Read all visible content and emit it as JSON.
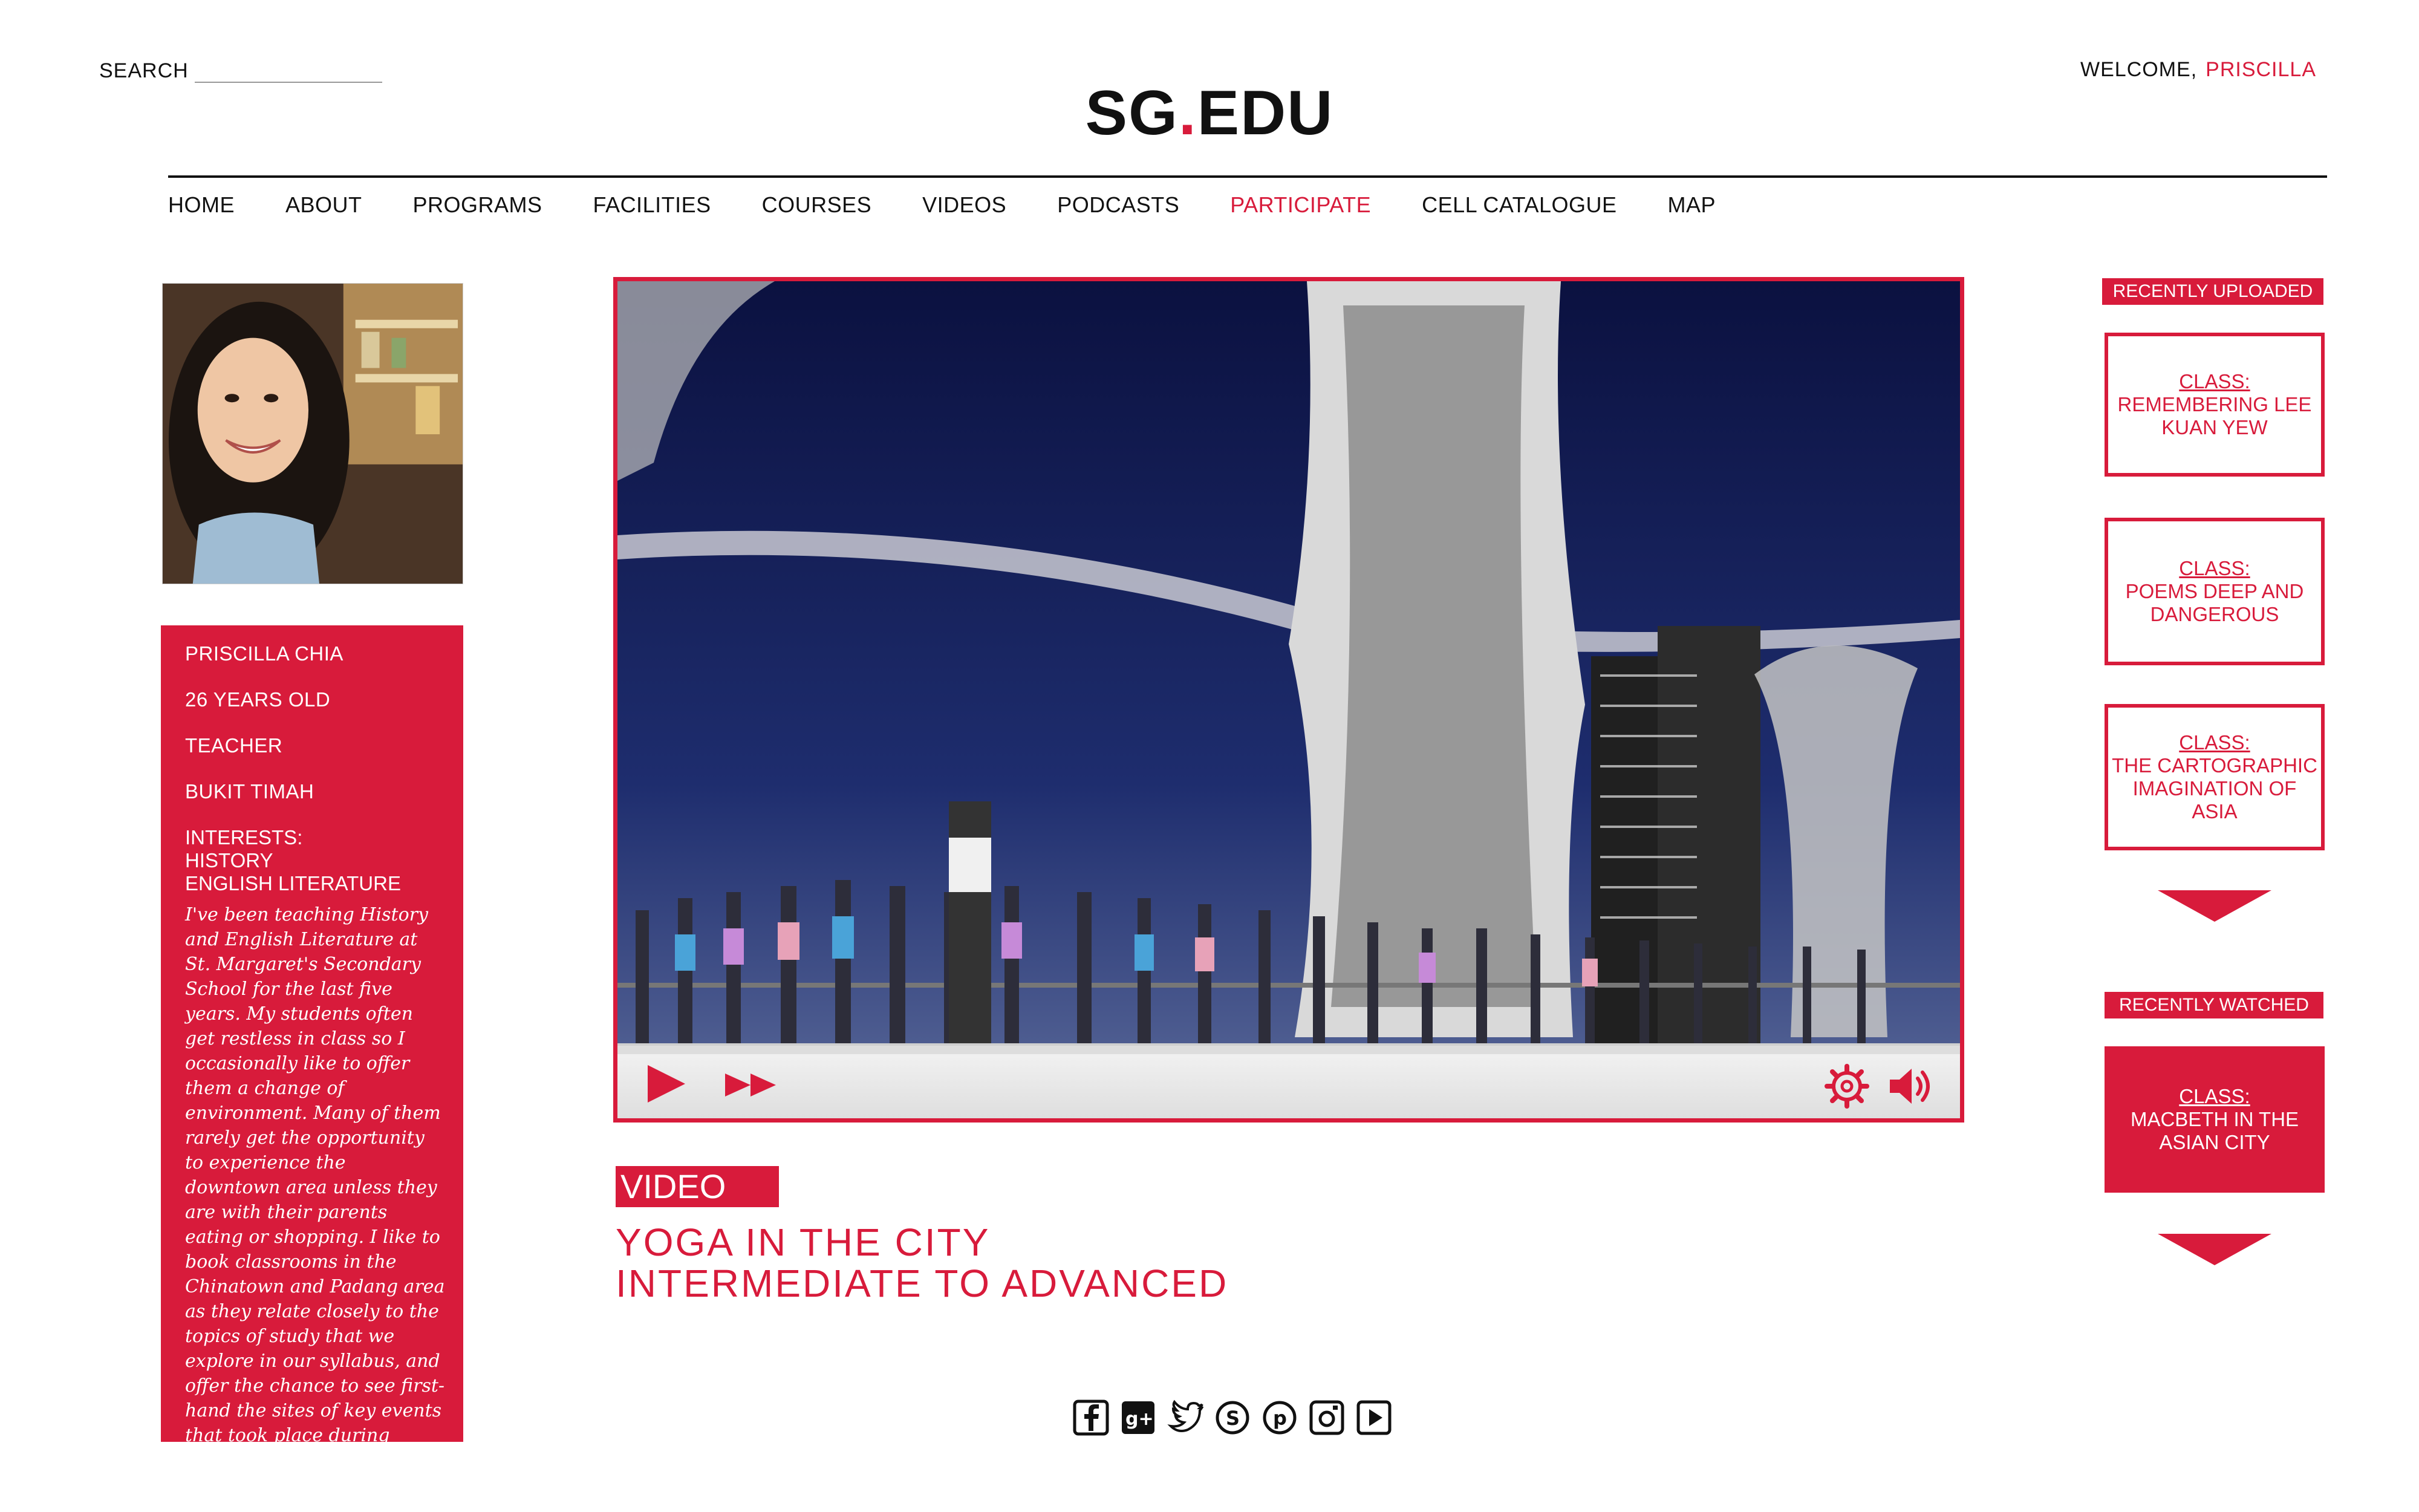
{
  "header": {
    "search_label": "SEARCH",
    "search_value": "",
    "logo_left": "SG",
    "logo_dot": ".",
    "logo_right": "EDU",
    "welcome_label": "WELCOME,",
    "welcome_name": "PRISCILLA"
  },
  "nav": {
    "items": [
      "HOME",
      "ABOUT",
      "PROGRAMS",
      "FACILITIES",
      "COURSES",
      "VIDEOS",
      "PODCASTS",
      "PARTICIPATE",
      "CELL CATALOGUE",
      "MAP"
    ],
    "active": "PARTICIPATE"
  },
  "profile": {
    "name": "PRISCILLA CHIA",
    "age": "26 YEARS OLD",
    "job": "TEACHER",
    "location": "BUKIT TIMAH",
    "interests_label": "INTERESTS:",
    "interest_1": "HISTORY",
    "interest_2": "ENGLISH LITERATURE",
    "bio": "I've been teaching History and English Literature at St. Margaret's Secondary School for the last five years. My students often get restless in class so I occasionally like to offer them a change of environment. Many of them rarely get the opportunity to experience the downtown area unless they are with their parents eating or shopping. I like to book classrooms in the Chinatown and Padang area as they relate closely to the topics of study that we explore in our syllabus, and offer the chance to see first-hand the sites of key events that took place during Singapore's growing years."
  },
  "video": {
    "badge": "VIDEO",
    "title_line1": "YOGA IN THE CITY",
    "title_line2": "INTERMEDIATE TO ADVANCED",
    "progress": 0
  },
  "recently_uploaded": {
    "heading": "RECENTLY UPLOADED",
    "items": [
      {
        "label": "CLASS:",
        "title": "REMEMBERING LEE KUAN YEW"
      },
      {
        "label": "CLASS:",
        "title": "POEMS DEEP AND DANGEROUS"
      },
      {
        "label": "CLASS:",
        "title": "THE CARTOGRAPHIC IMAGINATION OF ASIA"
      }
    ]
  },
  "recently_watched": {
    "heading": "RECENTLY WATCHED",
    "items": [
      {
        "label": "CLASS:",
        "title": "MACBETH IN THE ASIAN CITY"
      }
    ]
  },
  "social": [
    "facebook-icon",
    "google-plus-icon",
    "twitter-icon",
    "skype-icon",
    "pinterest-icon",
    "instagram-icon",
    "youtube-icon"
  ],
  "colors": {
    "accent": "#d81b3b",
    "text": "#111111",
    "background": "#ffffff"
  }
}
